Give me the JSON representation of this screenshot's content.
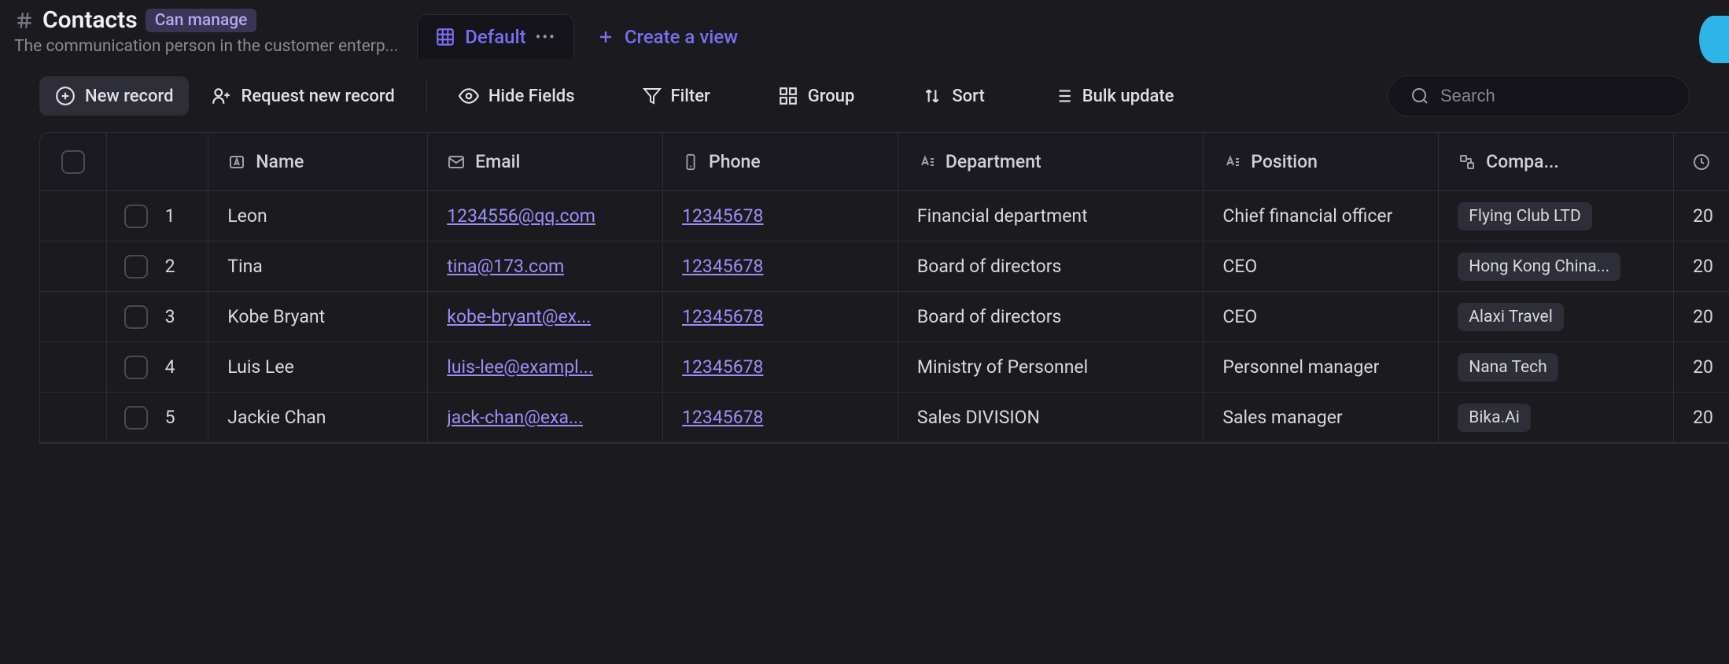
{
  "header": {
    "title": "Contacts",
    "badge": "Can manage",
    "subtitle": "The communication person in the customer enterp..."
  },
  "tabs": {
    "default": "Default",
    "create_view": "Create a view"
  },
  "toolbar": {
    "new_record": "New record",
    "request_new_record": "Request new record",
    "hide_fields": "Hide Fields",
    "filter": "Filter",
    "group": "Group",
    "sort": "Sort",
    "bulk_update": "Bulk update",
    "search_placeholder": "Search"
  },
  "columns": {
    "name": "Name",
    "email": "Email",
    "phone": "Phone",
    "department": "Department",
    "position": "Position",
    "company": "Compa..."
  },
  "rows": [
    {
      "num": "1",
      "name": "Leon",
      "email": "1234556@qq.com",
      "phone": "12345678",
      "department": "Financial department",
      "position": "Chief financial officer",
      "company": "Flying Club LTD",
      "extra": "20"
    },
    {
      "num": "2",
      "name": "Tina",
      "email": "tina@173.com",
      "phone": "12345678",
      "department": "Board of directors",
      "position": "CEO",
      "company": "Hong Kong China...",
      "extra": "20"
    },
    {
      "num": "3",
      "name": "Kobe Bryant",
      "email": "kobe-bryant@ex...",
      "phone": "12345678",
      "department": "Board of directors",
      "position": "CEO",
      "company": "Alaxi Travel",
      "extra": "20"
    },
    {
      "num": "4",
      "name": "Luis Lee",
      "email": "luis-lee@exampl...",
      "phone": "12345678",
      "department": "Ministry of Personnel",
      "position": "Personnel manager",
      "company": "Nana Tech",
      "extra": "20"
    },
    {
      "num": "5",
      "name": "Jackie Chan",
      "email": "jack-chan@exa...",
      "phone": "12345678",
      "department": "Sales DIVISION",
      "position": "Sales manager",
      "company": "Bika.Ai",
      "extra": "20"
    }
  ]
}
